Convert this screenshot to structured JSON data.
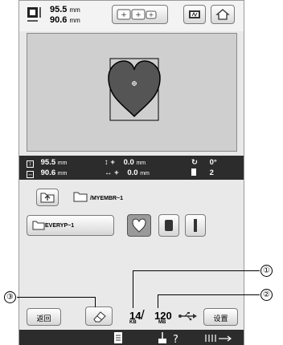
{
  "header": {
    "width_value": "95.5",
    "height_value": "90.6",
    "unit": "mm"
  },
  "info_bar": {
    "size_w": "95.5",
    "size_h": "90.6",
    "move_y": "0.0",
    "move_x": "0.0",
    "unit": "mm",
    "rotation": "0°",
    "color_count": "2"
  },
  "path": {
    "label": "/MYEMBR~1"
  },
  "folder": {
    "label": "EVERYP~1"
  },
  "capacity": {
    "used": "14",
    "used_unit": "KB",
    "separator": "/",
    "total": "120",
    "total_unit": "MB"
  },
  "buttons": {
    "back": "返回",
    "settings": "设置"
  },
  "callouts": {
    "one": "①",
    "two": "②",
    "three": "③"
  },
  "colors": {
    "heart_fill": "#555555",
    "dark_bar": "#2c2c2c"
  }
}
